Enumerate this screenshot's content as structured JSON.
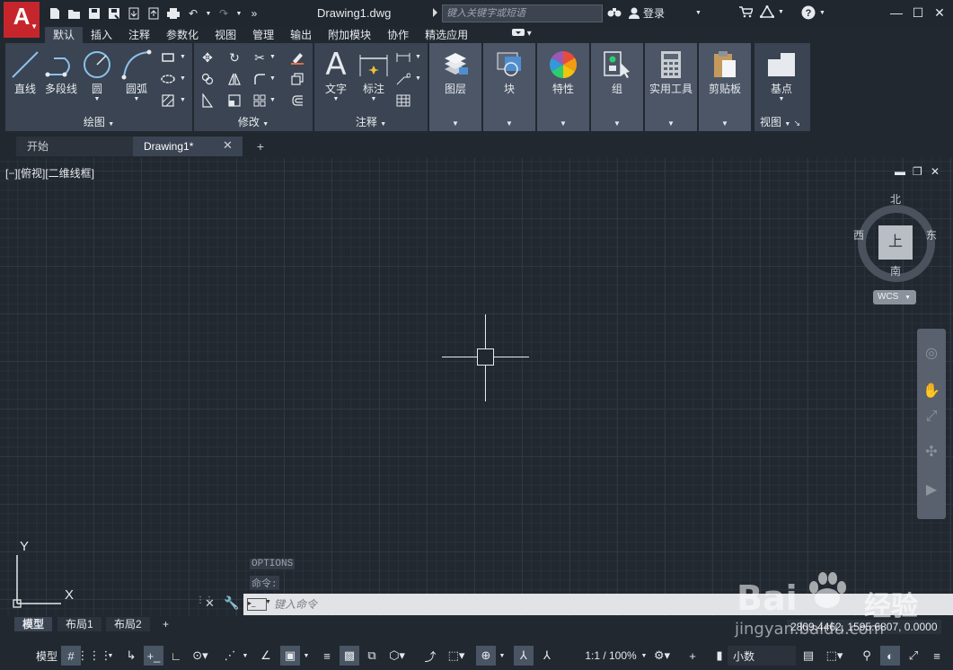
{
  "title_bar": {
    "app_logo": "A",
    "document_title": "Drawing1.dwg",
    "search_placeholder": "键入关键字或短语",
    "signin_label": "登录",
    "quick_access": [
      "new-icon",
      "open-icon",
      "save-icon",
      "save-as-icon",
      "open-from-web-icon",
      "save-to-web-icon",
      "plot-icon",
      "undo-icon",
      "redo-icon",
      "more-icon"
    ]
  },
  "ribbon_tabs": [
    "默认",
    "插入",
    "注释",
    "参数化",
    "视图",
    "管理",
    "输出",
    "附加模块",
    "协作",
    "精选应用"
  ],
  "ribbon": {
    "draw": {
      "label": "绘图",
      "line": "直线",
      "polyline": "多段线",
      "circle": "圆",
      "arc": "圆弧"
    },
    "modify": {
      "label": "修改"
    },
    "annotation": {
      "label": "注释",
      "text": "文字",
      "dimension": "标注"
    },
    "layers": "图层",
    "block": "块",
    "properties": "特性",
    "groups": "组",
    "utilities": "实用工具",
    "clipboard": "剪贴板",
    "view": {
      "label": "视图",
      "base": "基点"
    }
  },
  "file_tabs": {
    "start": "开始",
    "drawing": "Drawing1*"
  },
  "viewport": {
    "label": "[−][俯视][二维线框]"
  },
  "viewcube": {
    "top": "上",
    "north": "北",
    "south": "南",
    "east": "东",
    "west": "西",
    "wcs": "WCS"
  },
  "ucs": {
    "x": "X",
    "y": "Y"
  },
  "command_line": {
    "history": [
      "OPTIONS",
      "命令:"
    ],
    "placeholder": "键入命令"
  },
  "layout_tabs": [
    "模型",
    "布局1",
    "布局2"
  ],
  "coordinates": "2809.4462, 1595.6807, 0.0000",
  "status_bar": {
    "model": "模型",
    "scale": "1:1 / 100%",
    "units": "小数"
  },
  "watermark": {
    "brand": "Bai",
    "brand_cn": "经验",
    "url": "jingyan.baidu.com"
  }
}
